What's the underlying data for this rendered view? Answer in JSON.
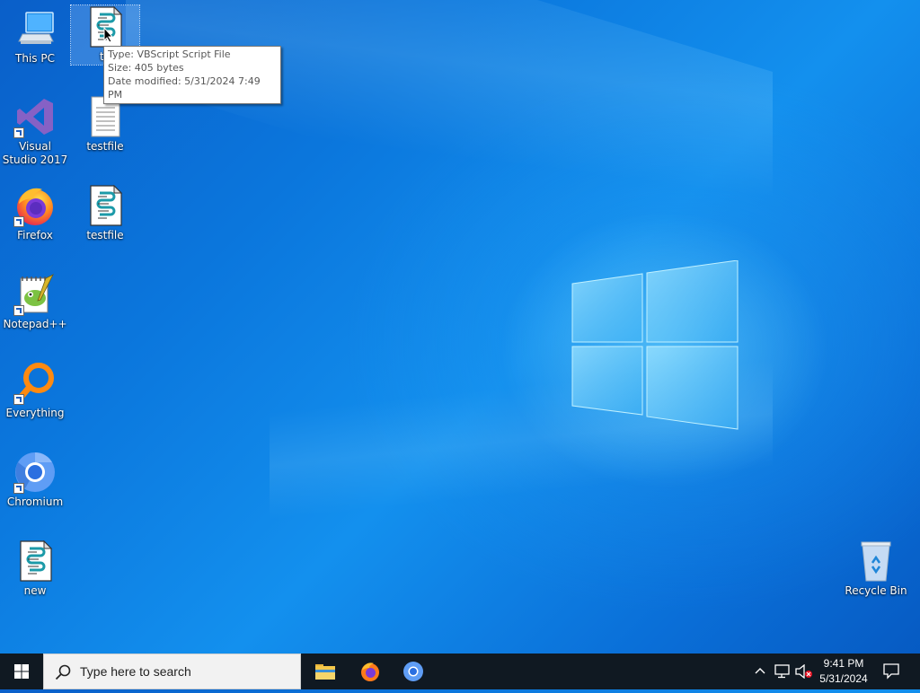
{
  "desktop": {
    "icons": [
      {
        "label": "This PC",
        "icon": "this-pc-icon"
      },
      {
        "label": "testfile",
        "icon": "vbscript-file-icon"
      },
      {
        "label": "Visual Studio 2017",
        "icon": "visual-studio-icon"
      },
      {
        "label": "testfile",
        "icon": "text-file-icon"
      },
      {
        "label": "Firefox",
        "icon": "firefox-icon"
      },
      {
        "label": "testfile",
        "icon": "vbscript-file-icon"
      },
      {
        "label": "Notepad++",
        "icon": "notepad-plus-plus-icon"
      },
      {
        "label": "Everything",
        "icon": "everything-search-icon"
      },
      {
        "label": "Chromium",
        "icon": "chromium-icon"
      },
      {
        "label": "new",
        "icon": "vbscript-file-icon"
      },
      {
        "label": "Recycle Bin",
        "icon": "recycle-bin-icon"
      }
    ],
    "selected_label_partial": "te"
  },
  "tooltip": {
    "type": "Type: VBScript Script File",
    "size": "Size: 405 bytes",
    "modified": "Date modified: 5/31/2024 7:49 PM"
  },
  "taskbar": {
    "search_placeholder": "Type here to search",
    "apps": [
      "file-explorer-icon",
      "firefox-icon",
      "chromium-icon"
    ],
    "clock": {
      "time": "9:41 PM",
      "date": "5/31/2024"
    }
  },
  "colors": {
    "taskbar_bg": "#101922",
    "desktop_accent": "#0b77dd"
  }
}
